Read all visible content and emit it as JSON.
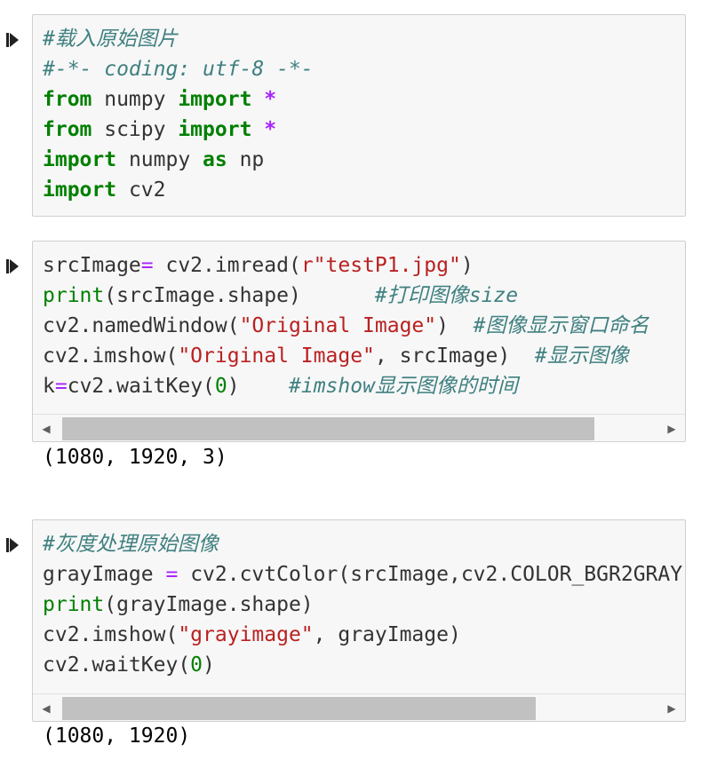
{
  "cells": [
    {
      "lines": [
        [
          {
            "t": "#载入原始图片",
            "c": "cm"
          }
        ],
        [
          {
            "t": "#-*- coding: utf-8 -*-",
            "c": "cm"
          }
        ],
        [
          {
            "t": "from",
            "c": "kw"
          },
          {
            "t": " numpy ",
            "c": ""
          },
          {
            "t": "import",
            "c": "kw"
          },
          {
            "t": " ",
            "c": ""
          },
          {
            "t": "*",
            "c": "op"
          }
        ],
        [
          {
            "t": "from",
            "c": "kw"
          },
          {
            "t": " scipy ",
            "c": ""
          },
          {
            "t": "import",
            "c": "kw"
          },
          {
            "t": " ",
            "c": ""
          },
          {
            "t": "*",
            "c": "op"
          }
        ],
        [
          {
            "t": "import",
            "c": "kw"
          },
          {
            "t": " numpy ",
            "c": ""
          },
          {
            "t": "as",
            "c": "kw"
          },
          {
            "t": " np",
            "c": ""
          }
        ],
        [
          {
            "t": "import",
            "c": "kw"
          },
          {
            "t": " cv2",
            "c": ""
          }
        ]
      ],
      "output": null
    },
    {
      "lines": [
        [
          {
            "t": "srcImage",
            "c": ""
          },
          {
            "t": "=",
            "c": "eq"
          },
          {
            "t": " cv2.imread(",
            "c": ""
          },
          {
            "t": "r\"testP1.jpg\"",
            "c": "st"
          },
          {
            "t": ")",
            "c": ""
          }
        ],
        [
          {
            "t": "print",
            "c": "bi"
          },
          {
            "t": "(srcImage.shape)      ",
            "c": ""
          },
          {
            "t": "#打印图像size",
            "c": "cm"
          }
        ],
        [
          {
            "t": "cv2.namedWindow(",
            "c": ""
          },
          {
            "t": "\"Original Image\"",
            "c": "st"
          },
          {
            "t": ")  ",
            "c": ""
          },
          {
            "t": "#图像显示窗口命名",
            "c": "cm"
          }
        ],
        [
          {
            "t": "cv2.imshow(",
            "c": ""
          },
          {
            "t": "\"Original Image\"",
            "c": "st"
          },
          {
            "t": ", srcImage)  ",
            "c": ""
          },
          {
            "t": "#显示图像",
            "c": "cm"
          }
        ],
        [
          {
            "t": "k",
            "c": ""
          },
          {
            "t": "=",
            "c": "eq"
          },
          {
            "t": "cv2.waitKey(",
            "c": ""
          },
          {
            "t": "0",
            "c": "nm"
          },
          {
            "t": ")    ",
            "c": ""
          },
          {
            "t": "#imshow显示图像的时间",
            "c": "cm"
          }
        ]
      ],
      "output": "(1080, 1920, 3)",
      "scroll_fraction": 0.9
    },
    {
      "lines": [
        [
          {
            "t": "#灰度处理原始图像",
            "c": "cm"
          }
        ],
        [
          {
            "t": "grayImage ",
            "c": ""
          },
          {
            "t": "=",
            "c": "eq"
          },
          {
            "t": " cv2.cvtColor(srcImage,cv2.COLOR_BGR2GRAY",
            "c": ""
          }
        ],
        [
          {
            "t": "print",
            "c": "bi"
          },
          {
            "t": "(grayImage.shape)",
            "c": ""
          }
        ],
        [
          {
            "t": "cv2.imshow(",
            "c": ""
          },
          {
            "t": "\"grayimage\"",
            "c": "st"
          },
          {
            "t": ", grayImage)",
            "c": ""
          }
        ],
        [
          {
            "t": "cv2.waitKey(",
            "c": ""
          },
          {
            "t": "0",
            "c": "nm"
          },
          {
            "t": ")",
            "c": ""
          }
        ]
      ],
      "output": "(1080, 1920)",
      "scroll_fraction": 0.8
    }
  ],
  "icons": {
    "run": "run-cell-icon",
    "scroll_left": "scroll-left-arrow-icon",
    "scroll_right": "scroll-right-arrow-icon"
  }
}
